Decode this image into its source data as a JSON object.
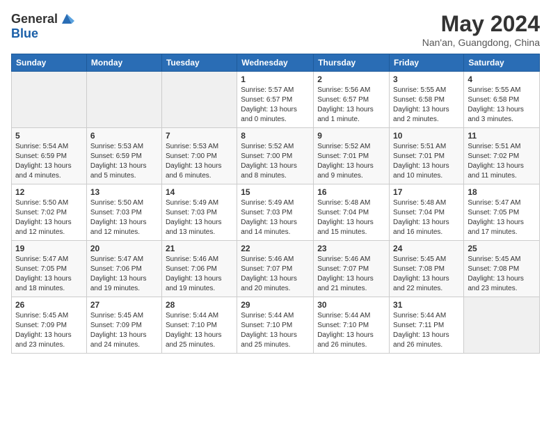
{
  "logo": {
    "general": "General",
    "blue": "Blue"
  },
  "title": "May 2024",
  "location": "Nan'an, Guangdong, China",
  "days_of_week": [
    "Sunday",
    "Monday",
    "Tuesday",
    "Wednesday",
    "Thursday",
    "Friday",
    "Saturday"
  ],
  "weeks": [
    [
      {
        "day": "",
        "info": ""
      },
      {
        "day": "",
        "info": ""
      },
      {
        "day": "",
        "info": ""
      },
      {
        "day": "1",
        "info": "Sunrise: 5:57 AM\nSunset: 6:57 PM\nDaylight: 13 hours and 0 minutes."
      },
      {
        "day": "2",
        "info": "Sunrise: 5:56 AM\nSunset: 6:57 PM\nDaylight: 13 hours and 1 minute."
      },
      {
        "day": "3",
        "info": "Sunrise: 5:55 AM\nSunset: 6:58 PM\nDaylight: 13 hours and 2 minutes."
      },
      {
        "day": "4",
        "info": "Sunrise: 5:55 AM\nSunset: 6:58 PM\nDaylight: 13 hours and 3 minutes."
      }
    ],
    [
      {
        "day": "5",
        "info": "Sunrise: 5:54 AM\nSunset: 6:59 PM\nDaylight: 13 hours and 4 minutes."
      },
      {
        "day": "6",
        "info": "Sunrise: 5:53 AM\nSunset: 6:59 PM\nDaylight: 13 hours and 5 minutes."
      },
      {
        "day": "7",
        "info": "Sunrise: 5:53 AM\nSunset: 7:00 PM\nDaylight: 13 hours and 6 minutes."
      },
      {
        "day": "8",
        "info": "Sunrise: 5:52 AM\nSunset: 7:00 PM\nDaylight: 13 hours and 8 minutes."
      },
      {
        "day": "9",
        "info": "Sunrise: 5:52 AM\nSunset: 7:01 PM\nDaylight: 13 hours and 9 minutes."
      },
      {
        "day": "10",
        "info": "Sunrise: 5:51 AM\nSunset: 7:01 PM\nDaylight: 13 hours and 10 minutes."
      },
      {
        "day": "11",
        "info": "Sunrise: 5:51 AM\nSunset: 7:02 PM\nDaylight: 13 hours and 11 minutes."
      }
    ],
    [
      {
        "day": "12",
        "info": "Sunrise: 5:50 AM\nSunset: 7:02 PM\nDaylight: 13 hours and 12 minutes."
      },
      {
        "day": "13",
        "info": "Sunrise: 5:50 AM\nSunset: 7:03 PM\nDaylight: 13 hours and 12 minutes."
      },
      {
        "day": "14",
        "info": "Sunrise: 5:49 AM\nSunset: 7:03 PM\nDaylight: 13 hours and 13 minutes."
      },
      {
        "day": "15",
        "info": "Sunrise: 5:49 AM\nSunset: 7:03 PM\nDaylight: 13 hours and 14 minutes."
      },
      {
        "day": "16",
        "info": "Sunrise: 5:48 AM\nSunset: 7:04 PM\nDaylight: 13 hours and 15 minutes."
      },
      {
        "day": "17",
        "info": "Sunrise: 5:48 AM\nSunset: 7:04 PM\nDaylight: 13 hours and 16 minutes."
      },
      {
        "day": "18",
        "info": "Sunrise: 5:47 AM\nSunset: 7:05 PM\nDaylight: 13 hours and 17 minutes."
      }
    ],
    [
      {
        "day": "19",
        "info": "Sunrise: 5:47 AM\nSunset: 7:05 PM\nDaylight: 13 hours and 18 minutes."
      },
      {
        "day": "20",
        "info": "Sunrise: 5:47 AM\nSunset: 7:06 PM\nDaylight: 13 hours and 19 minutes."
      },
      {
        "day": "21",
        "info": "Sunrise: 5:46 AM\nSunset: 7:06 PM\nDaylight: 13 hours and 19 minutes."
      },
      {
        "day": "22",
        "info": "Sunrise: 5:46 AM\nSunset: 7:07 PM\nDaylight: 13 hours and 20 minutes."
      },
      {
        "day": "23",
        "info": "Sunrise: 5:46 AM\nSunset: 7:07 PM\nDaylight: 13 hours and 21 minutes."
      },
      {
        "day": "24",
        "info": "Sunrise: 5:45 AM\nSunset: 7:08 PM\nDaylight: 13 hours and 22 minutes."
      },
      {
        "day": "25",
        "info": "Sunrise: 5:45 AM\nSunset: 7:08 PM\nDaylight: 13 hours and 23 minutes."
      }
    ],
    [
      {
        "day": "26",
        "info": "Sunrise: 5:45 AM\nSunset: 7:09 PM\nDaylight: 13 hours and 23 minutes."
      },
      {
        "day": "27",
        "info": "Sunrise: 5:45 AM\nSunset: 7:09 PM\nDaylight: 13 hours and 24 minutes."
      },
      {
        "day": "28",
        "info": "Sunrise: 5:44 AM\nSunset: 7:10 PM\nDaylight: 13 hours and 25 minutes."
      },
      {
        "day": "29",
        "info": "Sunrise: 5:44 AM\nSunset: 7:10 PM\nDaylight: 13 hours and 25 minutes."
      },
      {
        "day": "30",
        "info": "Sunrise: 5:44 AM\nSunset: 7:10 PM\nDaylight: 13 hours and 26 minutes."
      },
      {
        "day": "31",
        "info": "Sunrise: 5:44 AM\nSunset: 7:11 PM\nDaylight: 13 hours and 26 minutes."
      },
      {
        "day": "",
        "info": ""
      }
    ]
  ]
}
